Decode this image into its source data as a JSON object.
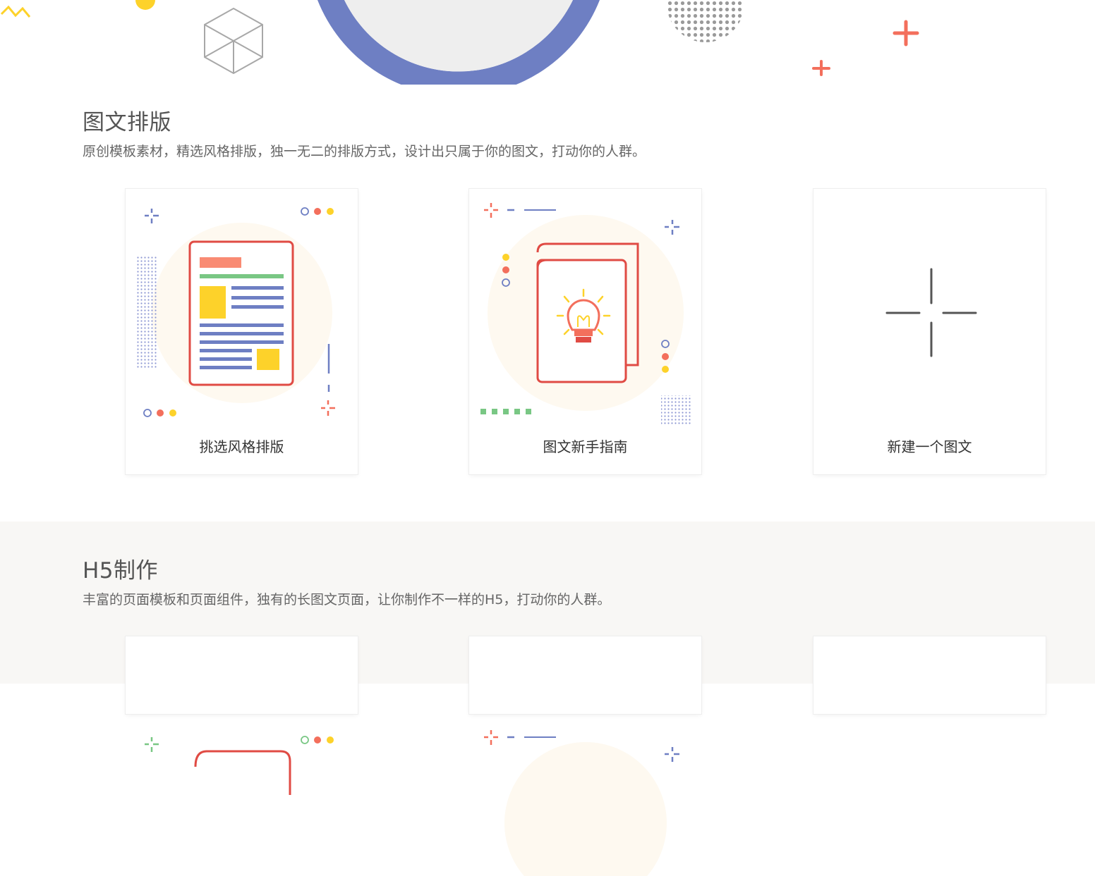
{
  "sections": [
    {
      "title": "图文排版",
      "description": "原创模板素材，精选风格排版，独一无二的排版方式，设计出只属于你的图文，打动你的人群。",
      "cards": [
        {
          "label": "挑选风格排版",
          "icon": "layout-document-icon"
        },
        {
          "label": "图文新手指南",
          "icon": "lightbulb-book-icon"
        },
        {
          "label": "新建一个图文",
          "icon": "plus-icon"
        }
      ]
    },
    {
      "title": "H5制作",
      "description": "丰富的页面模板和页面组件，独有的长图文页面，让你制作不一样的H5，打动你的人群。"
    }
  ],
  "colors": {
    "purple": "#6e7fc3",
    "coral": "#f36f5c",
    "red": "#e04b44",
    "yellow": "#fdd22a",
    "green": "#79c784",
    "cream": "#fef9f0",
    "section_bg": "#f8f7f5"
  }
}
